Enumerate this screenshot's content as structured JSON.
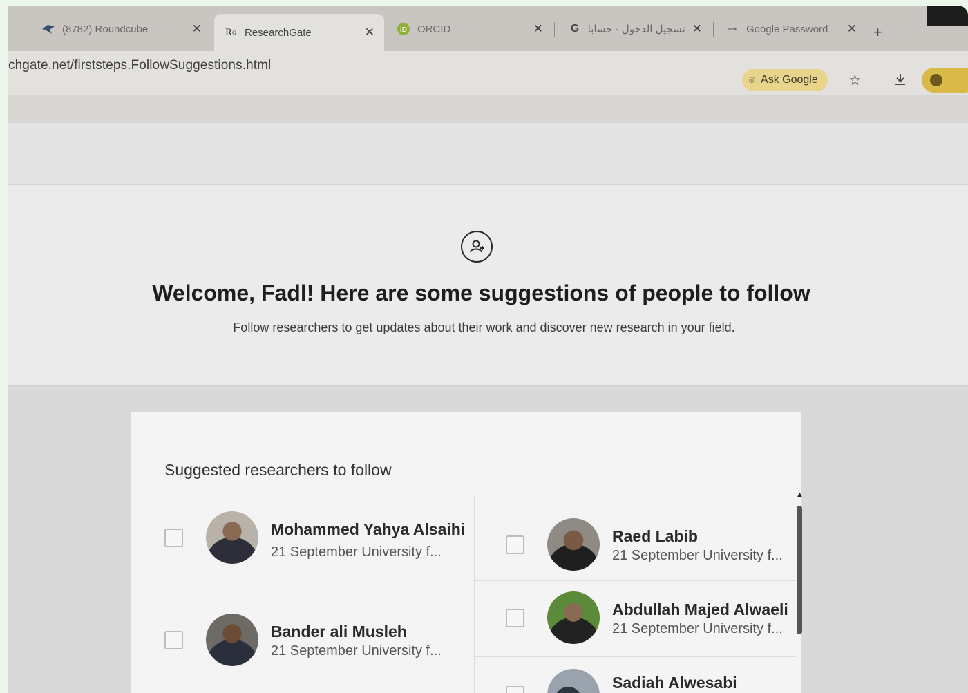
{
  "browser": {
    "tabs": [
      {
        "label": "(8782) Roundcube",
        "favicon": "roundcube-bird-icon",
        "active": false
      },
      {
        "label": "ResearchGate",
        "favicon": "researchgate-icon",
        "active": true
      },
      {
        "label": "ORCID",
        "favicon": "orcid-icon",
        "active": false
      },
      {
        "label": "تسجيل الدخول - حسابات",
        "favicon": "google-g-icon",
        "active": false
      },
      {
        "label": "Google Password",
        "favicon": "key-icon",
        "active": false
      }
    ],
    "close_glyph": "✕",
    "new_tab_glyph": "+",
    "url": "chgate.net/firststeps.FollowSuggestions.html",
    "ask_google_label": "Ask Google"
  },
  "hero": {
    "title": "Welcome, Fadl! Here are some suggestions of people to follow",
    "subtitle": "Follow researchers to get updates about their work and discover new research in your field."
  },
  "suggestions": {
    "title": "Suggested researchers to follow",
    "people": [
      {
        "name": "Mohammed Yahya Alsaihi",
        "affiliation": "21 September University f..."
      },
      {
        "name": "Raed Labib",
        "affiliation": "21 September University f..."
      },
      {
        "name": "Bander ali Musleh",
        "affiliation": "21 September University f..."
      },
      {
        "name": "Abdullah Majed Alwaeli",
        "affiliation": "21 September University f..."
      },
      {
        "name": "Sadiah Alwesabi",
        "affiliation": ""
      }
    ]
  },
  "colors": {
    "active_tab": "#e3e1de",
    "ask_google_bg": "#e8d48a",
    "profile_bg": "#d9b947"
  }
}
